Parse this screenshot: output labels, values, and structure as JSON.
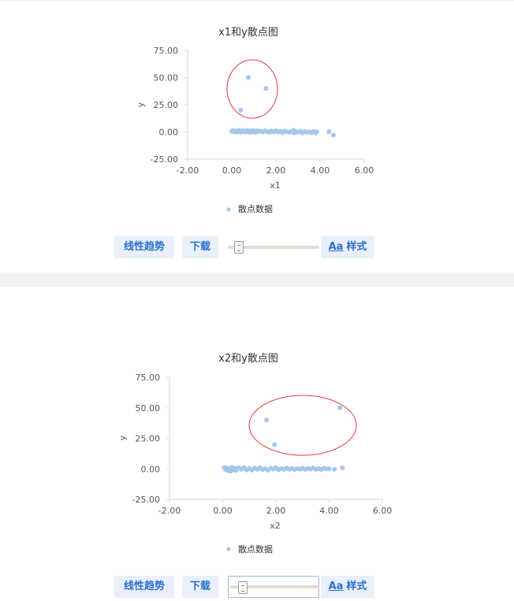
{
  "toolbar_labels": {
    "trend": "线性趋势",
    "download": "下载",
    "style_aa": "Aa",
    "style": "样式"
  },
  "colors": {
    "marker": "#a7c6ee",
    "axis": "#d6d6e8",
    "highlight_ellipse": "#e03a3a",
    "button_bg": "#e9f0fb",
    "button_text": "#2b6fd0"
  },
  "charts": [
    {
      "slider_value_fraction": 0.08,
      "slider_focused": false
    },
    {
      "slider_value_fraction": 0.12,
      "slider_focused": true
    }
  ],
  "chart_data": [
    {
      "type": "scatter",
      "title": "x1和y散点图",
      "xlabel": "x1",
      "ylabel": "y",
      "xlim": [
        -2,
        6
      ],
      "ylim": [
        -25,
        75
      ],
      "xticks": [
        "-2.00",
        "0.00",
        "2.00",
        "4.00",
        "6.00"
      ],
      "yticks": [
        "-25.00",
        "0.00",
        "25.00",
        "50.00",
        "75.00"
      ],
      "legend": "散点数据",
      "legend_position": "bottom",
      "grid": false,
      "series": [
        {
          "name": "散点数据",
          "points": [
            [
              0.75,
              50
            ],
            [
              1.55,
              40
            ],
            [
              0.4,
              20
            ],
            [
              0.0,
              0.5
            ],
            [
              0.05,
              1.2
            ],
            [
              0.1,
              0.3
            ],
            [
              0.15,
              1.0
            ],
            [
              0.2,
              -0.2
            ],
            [
              0.25,
              0.9
            ],
            [
              0.3,
              0.4
            ],
            [
              0.35,
              1.4
            ],
            [
              0.4,
              -0.3
            ],
            [
              0.45,
              0.8
            ],
            [
              0.5,
              0.2
            ],
            [
              0.55,
              1.1
            ],
            [
              0.6,
              -0.1
            ],
            [
              0.65,
              0.7
            ],
            [
              0.7,
              1.3
            ],
            [
              0.75,
              0.0
            ],
            [
              0.8,
              0.9
            ],
            [
              0.85,
              -0.4
            ],
            [
              0.9,
              0.6
            ],
            [
              0.95,
              1.2
            ],
            [
              1.0,
              0.1
            ],
            [
              1.05,
              0.8
            ],
            [
              1.1,
              -0.3
            ],
            [
              1.15,
              1.0
            ],
            [
              1.2,
              0.4
            ],
            [
              1.3,
              0.7
            ],
            [
              1.4,
              -0.2
            ],
            [
              1.5,
              1.1
            ],
            [
              1.6,
              0.3
            ],
            [
              1.7,
              -0.5
            ],
            [
              1.8,
              0.9
            ],
            [
              1.9,
              0.2
            ],
            [
              2.0,
              1.3
            ],
            [
              2.1,
              -0.1
            ],
            [
              2.2,
              0.6
            ],
            [
              2.3,
              -0.6
            ],
            [
              2.4,
              0.8
            ],
            [
              2.5,
              0.1
            ],
            [
              2.6,
              -0.3
            ],
            [
              2.7,
              0.5
            ],
            [
              2.8,
              1.5
            ],
            [
              2.85,
              -0.8
            ],
            [
              2.9,
              0.4
            ],
            [
              3.0,
              -0.2
            ],
            [
              3.1,
              0.6
            ],
            [
              3.2,
              -0.9
            ],
            [
              3.3,
              0.3
            ],
            [
              3.4,
              -0.4
            ],
            [
              3.5,
              0.2
            ],
            [
              3.6,
              -0.7
            ],
            [
              3.7,
              0.5
            ],
            [
              3.8,
              -1.0
            ],
            [
              3.85,
              0.1
            ],
            [
              4.4,
              0.2
            ],
            [
              4.6,
              -3.0
            ]
          ]
        }
      ]
    },
    {
      "type": "scatter",
      "title": "x2和y散点图",
      "xlabel": "x2",
      "ylabel": "y",
      "xlim": [
        -2,
        6
      ],
      "ylim": [
        -25,
        75
      ],
      "xticks": [
        "-2.00",
        "0.00",
        "2.00",
        "4.00",
        "6.00"
      ],
      "yticks": [
        "-25.00",
        "0.00",
        "25.00",
        "50.00",
        "75.00"
      ],
      "legend": "散点数据",
      "legend_position": "bottom",
      "grid": false,
      "series": [
        {
          "name": "散点数据",
          "points": [
            [
              4.4,
              50
            ],
            [
              1.65,
              40
            ],
            [
              1.95,
              20
            ],
            [
              0.05,
              1.0
            ],
            [
              0.1,
              -0.5
            ],
            [
              0.15,
              0.8
            ],
            [
              0.2,
              -1.5
            ],
            [
              0.25,
              0.3
            ],
            [
              0.3,
              -2.0
            ],
            [
              0.35,
              1.2
            ],
            [
              0.4,
              -0.8
            ],
            [
              0.45,
              0.5
            ],
            [
              0.5,
              -1.2
            ],
            [
              0.6,
              0.9
            ],
            [
              0.7,
              -0.4
            ],
            [
              0.8,
              1.1
            ],
            [
              0.9,
              -0.9
            ],
            [
              1.0,
              0.4
            ],
            [
              1.1,
              -1.0
            ],
            [
              1.2,
              0.7
            ],
            [
              1.3,
              -0.3
            ],
            [
              1.4,
              1.0
            ],
            [
              1.5,
              -0.6
            ],
            [
              1.6,
              0.2
            ],
            [
              1.7,
              -1.1
            ],
            [
              1.8,
              0.6
            ],
            [
              1.9,
              -0.2
            ],
            [
              2.0,
              0.9
            ],
            [
              2.1,
              -0.7
            ],
            [
              2.2,
              0.3
            ],
            [
              2.3,
              -0.5
            ],
            [
              2.4,
              0.8
            ],
            [
              2.5,
              -0.4
            ],
            [
              2.6,
              0.5
            ],
            [
              2.7,
              -0.6
            ],
            [
              2.8,
              0.2
            ],
            [
              2.9,
              -0.3
            ],
            [
              3.0,
              0.6
            ],
            [
              3.1,
              -0.5
            ],
            [
              3.2,
              0.4
            ],
            [
              3.3,
              -0.2
            ],
            [
              3.4,
              0.7
            ],
            [
              3.5,
              -0.4
            ],
            [
              3.6,
              0.3
            ],
            [
              3.7,
              -0.6
            ],
            [
              3.8,
              0.5
            ],
            [
              3.9,
              -0.1
            ],
            [
              4.0,
              0.2
            ],
            [
              4.2,
              -0.3
            ],
            [
              4.5,
              0.8
            ]
          ]
        }
      ]
    }
  ]
}
